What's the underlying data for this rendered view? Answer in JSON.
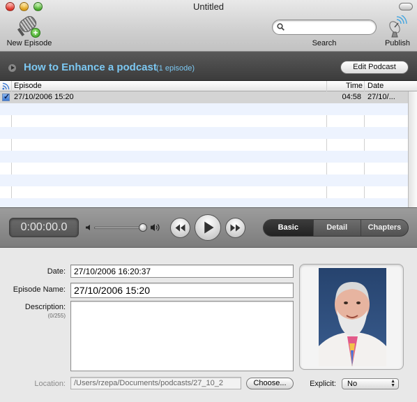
{
  "window": {
    "title": "Untitled"
  },
  "toolbar": {
    "new_episode_label": "New Episode",
    "search_label": "Search",
    "search_value": "",
    "search_placeholder": "",
    "publish_label": "Publish"
  },
  "podcast": {
    "title": "How to Enhance a  podcast",
    "episode_count": "(1 episode)",
    "edit_button": "Edit Podcast"
  },
  "episodes_table": {
    "columns": [
      "Episode",
      "Time",
      "Date"
    ],
    "rows": [
      {
        "checked": true,
        "episode": "27/10/2006 15:20",
        "time": "04:58",
        "date": "27/10/..."
      }
    ]
  },
  "player": {
    "timecode": "0:00:00.0",
    "volume_fraction": 0.9,
    "tabs": [
      "Basic",
      "Detail",
      "Chapters"
    ],
    "active_tab": "Basic"
  },
  "detail": {
    "date_label": "Date:",
    "date_value": "27/10/2006 16:20:37",
    "episode_name_label": "Episode Name:",
    "episode_name_value": "27/10/2006 15:20",
    "description_label": "Description:",
    "description_counter": "(0/255)",
    "description_value": "",
    "location_label": "Location:",
    "location_value": "/Users/rzepa/Documents/podcasts/27_10_2",
    "choose_button": "Choose...",
    "explicit_label": "Explicit:",
    "explicit_value": "No"
  },
  "colors": {
    "podcast_title": "#7cc8f2",
    "podbar_bg": "#4a4a4a",
    "row_stripe": "#edf3fe",
    "selected_row": "#d4d4d4"
  }
}
